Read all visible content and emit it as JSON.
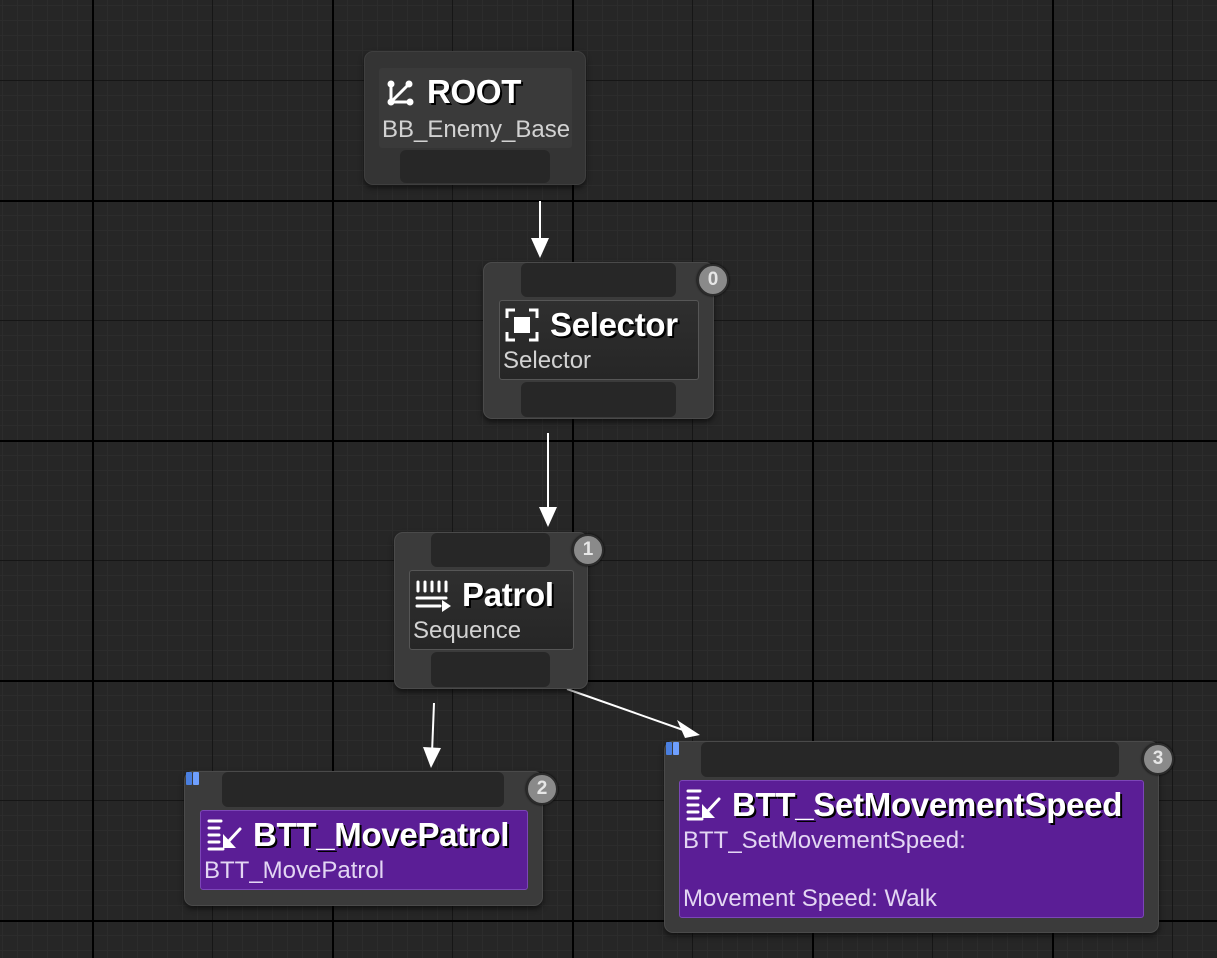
{
  "graph": {
    "nodes": [
      {
        "id": "root",
        "title": "ROOT",
        "subtitle": "BB_Enemy_Base",
        "icon": "root-icon"
      },
      {
        "id": "selector",
        "title": "Selector",
        "subtitle": "Selector",
        "icon": "selector-icon",
        "index": "0"
      },
      {
        "id": "patrol",
        "title": "Patrol",
        "subtitle": "Sequence",
        "icon": "sequence-icon",
        "index": "1"
      },
      {
        "id": "move_patrol",
        "title": "BTT_MovePatrol",
        "subtitle": "BTT_MovePatrol",
        "icon": "task-icon",
        "index": "2"
      },
      {
        "id": "set_speed",
        "title": "BTT_SetMovementSpeed",
        "subtitle": "BTT_SetMovementSpeed:",
        "detail": "Movement Speed: Walk",
        "icon": "task-icon",
        "index": "3"
      }
    ]
  },
  "colors": {
    "grid_background": "#262626",
    "composite_node": "#3b3b3b",
    "task_node": "#5b1e96",
    "wire": "#ffffff",
    "index_badge": "#8a8a8a"
  }
}
